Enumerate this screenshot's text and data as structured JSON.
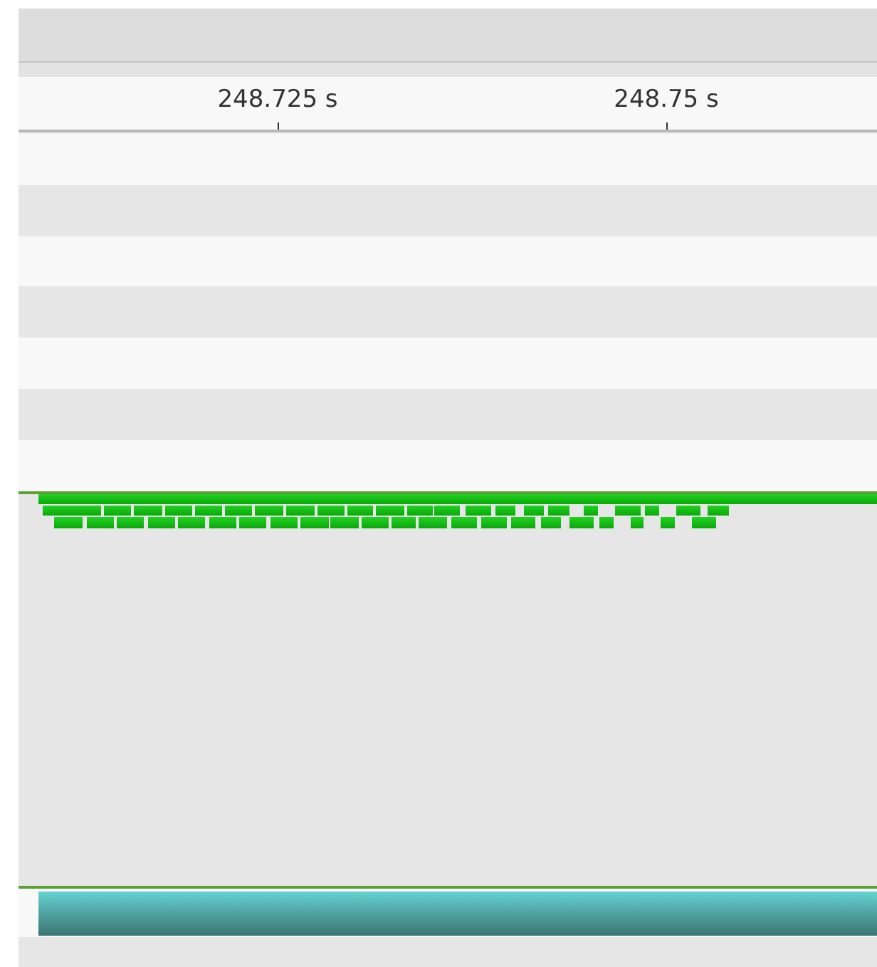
{
  "ruler": {
    "ticks": [
      {
        "label": "248.725 s"
      },
      {
        "label": "248.75 s"
      }
    ]
  }
}
